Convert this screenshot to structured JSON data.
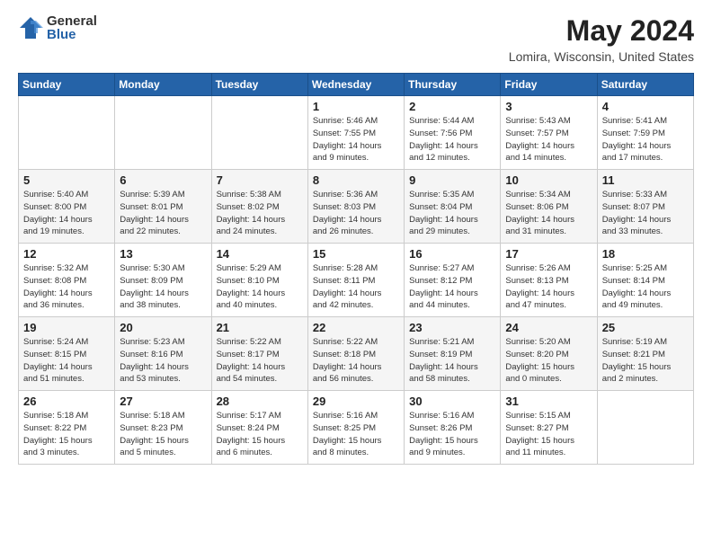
{
  "logo": {
    "general": "General",
    "blue": "Blue"
  },
  "title": "May 2024",
  "subtitle": "Lomira, Wisconsin, United States",
  "days_of_week": [
    "Sunday",
    "Monday",
    "Tuesday",
    "Wednesday",
    "Thursday",
    "Friday",
    "Saturday"
  ],
  "weeks": [
    [
      {
        "day": "",
        "info": ""
      },
      {
        "day": "",
        "info": ""
      },
      {
        "day": "",
        "info": ""
      },
      {
        "day": "1",
        "info": "Sunrise: 5:46 AM\nSunset: 7:55 PM\nDaylight: 14 hours\nand 9 minutes."
      },
      {
        "day": "2",
        "info": "Sunrise: 5:44 AM\nSunset: 7:56 PM\nDaylight: 14 hours\nand 12 minutes."
      },
      {
        "day": "3",
        "info": "Sunrise: 5:43 AM\nSunset: 7:57 PM\nDaylight: 14 hours\nand 14 minutes."
      },
      {
        "day": "4",
        "info": "Sunrise: 5:41 AM\nSunset: 7:59 PM\nDaylight: 14 hours\nand 17 minutes."
      }
    ],
    [
      {
        "day": "5",
        "info": "Sunrise: 5:40 AM\nSunset: 8:00 PM\nDaylight: 14 hours\nand 19 minutes."
      },
      {
        "day": "6",
        "info": "Sunrise: 5:39 AM\nSunset: 8:01 PM\nDaylight: 14 hours\nand 22 minutes."
      },
      {
        "day": "7",
        "info": "Sunrise: 5:38 AM\nSunset: 8:02 PM\nDaylight: 14 hours\nand 24 minutes."
      },
      {
        "day": "8",
        "info": "Sunrise: 5:36 AM\nSunset: 8:03 PM\nDaylight: 14 hours\nand 26 minutes."
      },
      {
        "day": "9",
        "info": "Sunrise: 5:35 AM\nSunset: 8:04 PM\nDaylight: 14 hours\nand 29 minutes."
      },
      {
        "day": "10",
        "info": "Sunrise: 5:34 AM\nSunset: 8:06 PM\nDaylight: 14 hours\nand 31 minutes."
      },
      {
        "day": "11",
        "info": "Sunrise: 5:33 AM\nSunset: 8:07 PM\nDaylight: 14 hours\nand 33 minutes."
      }
    ],
    [
      {
        "day": "12",
        "info": "Sunrise: 5:32 AM\nSunset: 8:08 PM\nDaylight: 14 hours\nand 36 minutes."
      },
      {
        "day": "13",
        "info": "Sunrise: 5:30 AM\nSunset: 8:09 PM\nDaylight: 14 hours\nand 38 minutes."
      },
      {
        "day": "14",
        "info": "Sunrise: 5:29 AM\nSunset: 8:10 PM\nDaylight: 14 hours\nand 40 minutes."
      },
      {
        "day": "15",
        "info": "Sunrise: 5:28 AM\nSunset: 8:11 PM\nDaylight: 14 hours\nand 42 minutes."
      },
      {
        "day": "16",
        "info": "Sunrise: 5:27 AM\nSunset: 8:12 PM\nDaylight: 14 hours\nand 44 minutes."
      },
      {
        "day": "17",
        "info": "Sunrise: 5:26 AM\nSunset: 8:13 PM\nDaylight: 14 hours\nand 47 minutes."
      },
      {
        "day": "18",
        "info": "Sunrise: 5:25 AM\nSunset: 8:14 PM\nDaylight: 14 hours\nand 49 minutes."
      }
    ],
    [
      {
        "day": "19",
        "info": "Sunrise: 5:24 AM\nSunset: 8:15 PM\nDaylight: 14 hours\nand 51 minutes."
      },
      {
        "day": "20",
        "info": "Sunrise: 5:23 AM\nSunset: 8:16 PM\nDaylight: 14 hours\nand 53 minutes."
      },
      {
        "day": "21",
        "info": "Sunrise: 5:22 AM\nSunset: 8:17 PM\nDaylight: 14 hours\nand 54 minutes."
      },
      {
        "day": "22",
        "info": "Sunrise: 5:22 AM\nSunset: 8:18 PM\nDaylight: 14 hours\nand 56 minutes."
      },
      {
        "day": "23",
        "info": "Sunrise: 5:21 AM\nSunset: 8:19 PM\nDaylight: 14 hours\nand 58 minutes."
      },
      {
        "day": "24",
        "info": "Sunrise: 5:20 AM\nSunset: 8:20 PM\nDaylight: 15 hours\nand 0 minutes."
      },
      {
        "day": "25",
        "info": "Sunrise: 5:19 AM\nSunset: 8:21 PM\nDaylight: 15 hours\nand 2 minutes."
      }
    ],
    [
      {
        "day": "26",
        "info": "Sunrise: 5:18 AM\nSunset: 8:22 PM\nDaylight: 15 hours\nand 3 minutes."
      },
      {
        "day": "27",
        "info": "Sunrise: 5:18 AM\nSunset: 8:23 PM\nDaylight: 15 hours\nand 5 minutes."
      },
      {
        "day": "28",
        "info": "Sunrise: 5:17 AM\nSunset: 8:24 PM\nDaylight: 15 hours\nand 6 minutes."
      },
      {
        "day": "29",
        "info": "Sunrise: 5:16 AM\nSunset: 8:25 PM\nDaylight: 15 hours\nand 8 minutes."
      },
      {
        "day": "30",
        "info": "Sunrise: 5:16 AM\nSunset: 8:26 PM\nDaylight: 15 hours\nand 9 minutes."
      },
      {
        "day": "31",
        "info": "Sunrise: 5:15 AM\nSunset: 8:27 PM\nDaylight: 15 hours\nand 11 minutes."
      },
      {
        "day": "",
        "info": ""
      }
    ]
  ]
}
